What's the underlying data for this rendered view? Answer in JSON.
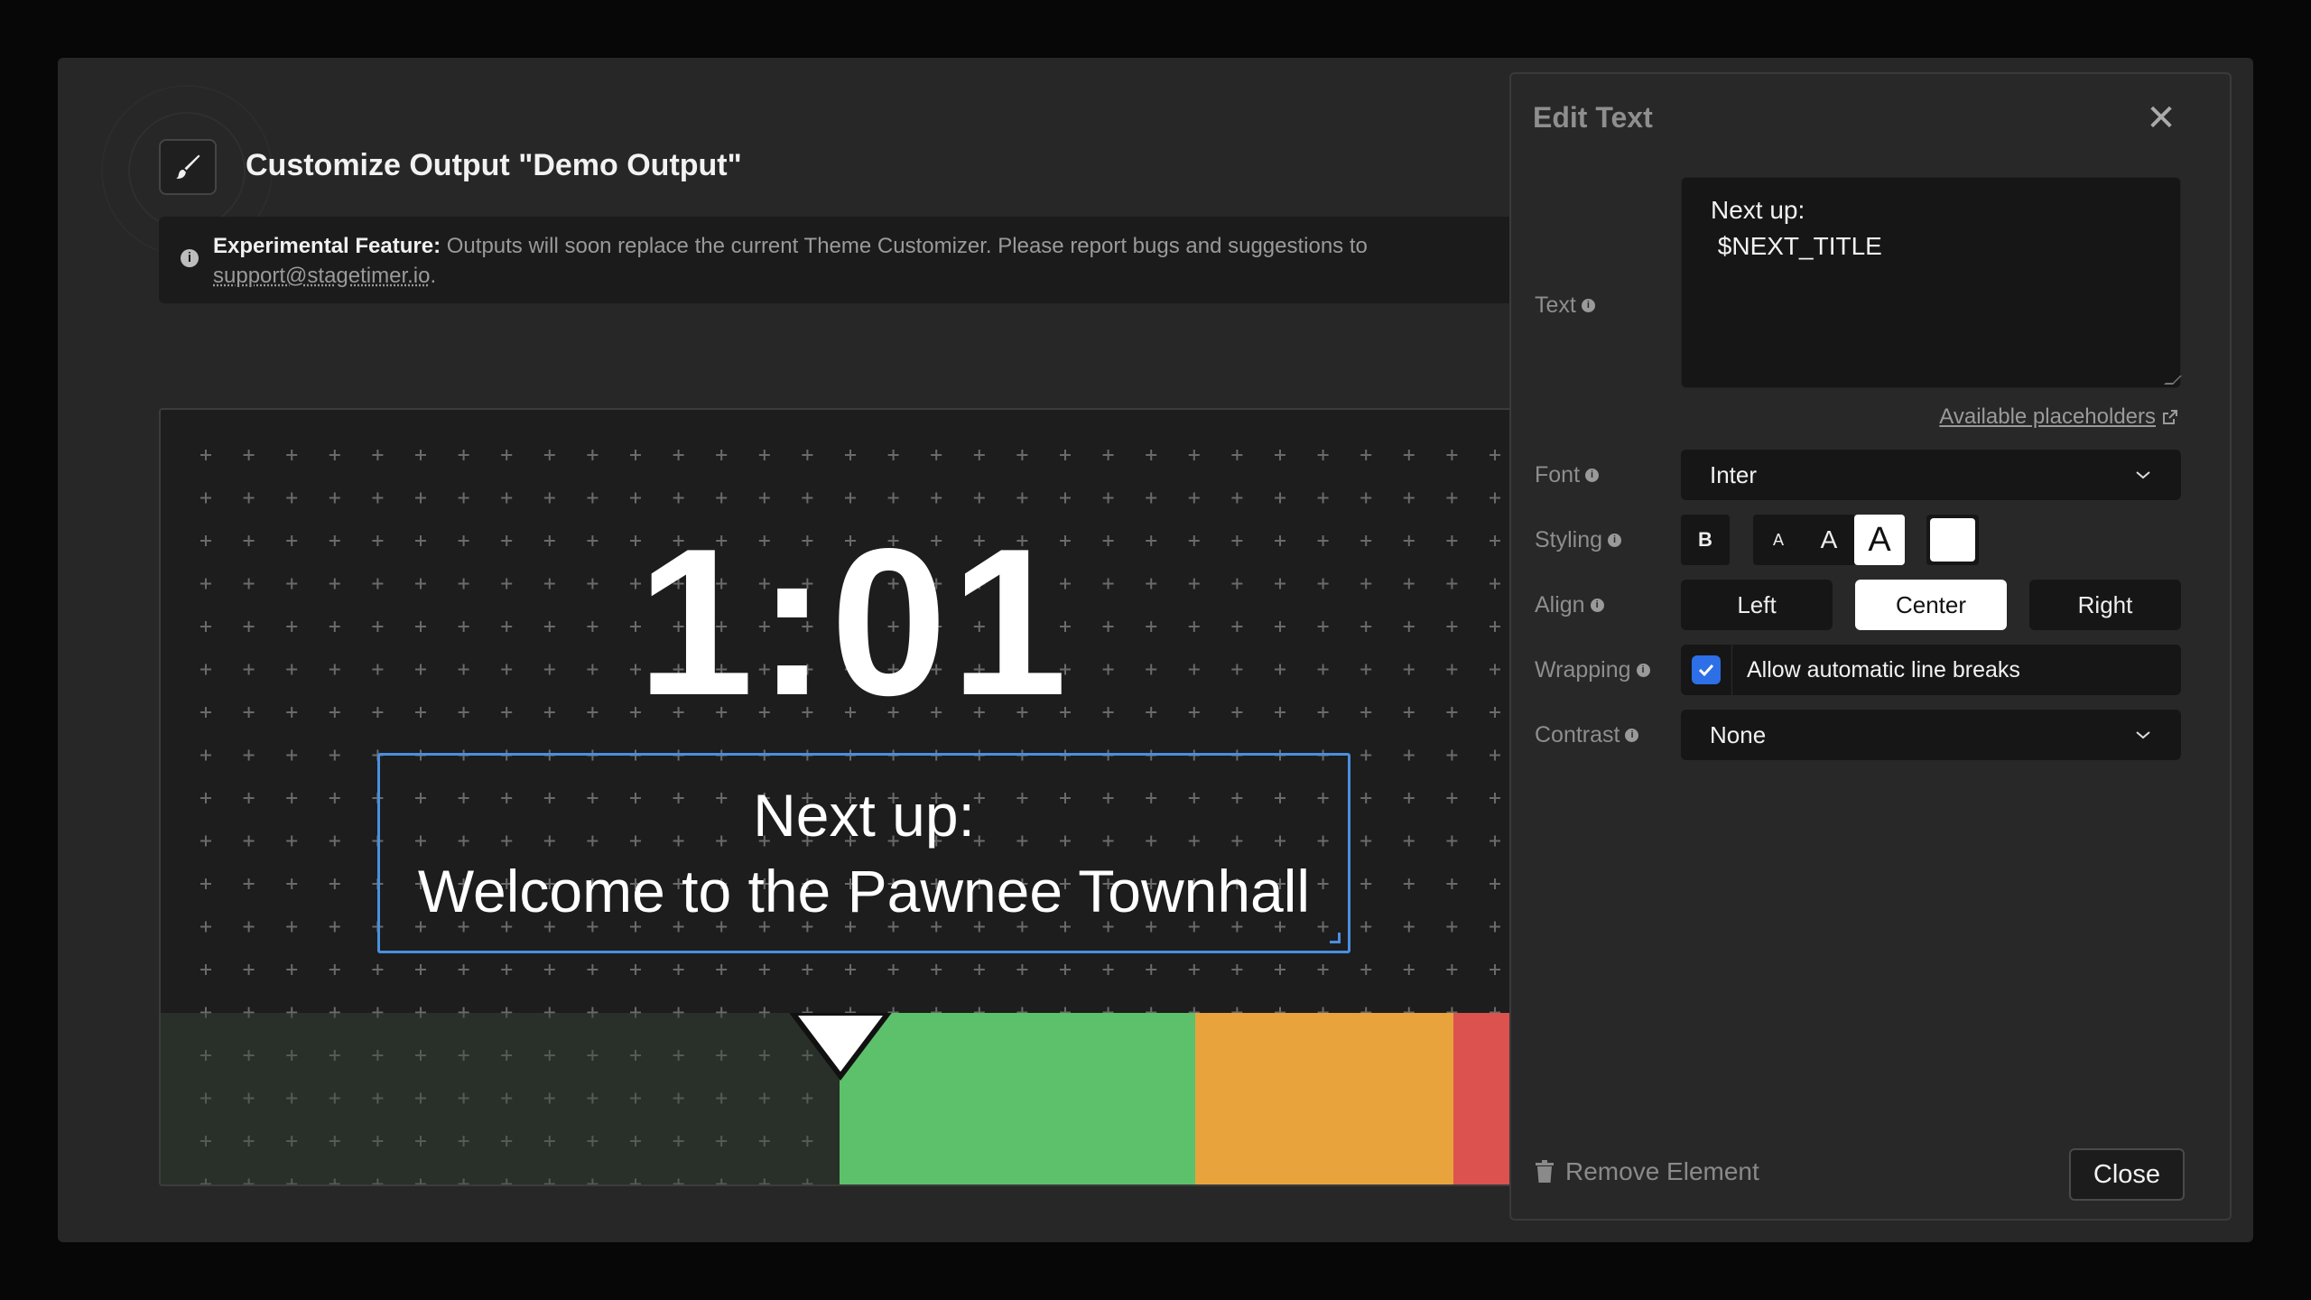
{
  "modal": {
    "title": "Customize Output \"Demo Output\"",
    "icon": "paintbrush-icon"
  },
  "notice": {
    "label": "Experimental Feature:",
    "text": " Outputs will soon replace the current Theme Customizer. Please report bugs and suggestions to ",
    "link": "support@stagetimer.io",
    "suffix": "."
  },
  "preview": {
    "timer": "1:01",
    "text_line1": "Next up:",
    "text_line2": "Welcome to the Pawnee Townhall",
    "progress_colors": {
      "elapsed": "#2f382f",
      "green": "#5cc16a",
      "orange": "#e9a33c",
      "red": "#dc524e"
    }
  },
  "panel": {
    "title": "Edit Text",
    "close_icon": "close-icon",
    "text_label": "Text",
    "text_value": "Next up:\n $NEXT_TITLE",
    "placeholders_link": "Available placeholders",
    "font_label": "Font",
    "font_value": "Inter",
    "styling_label": "Styling",
    "styling": {
      "bold": "B",
      "size_small": "A",
      "size_medium": "A",
      "size_large": "A",
      "color": "#ffffff"
    },
    "align_label": "Align",
    "align": {
      "left": "Left",
      "center": "Center",
      "right": "Right",
      "selected": "Center"
    },
    "wrapping_label": "Wrapping",
    "wrapping_checked": true,
    "wrapping_text": "Allow automatic line breaks",
    "contrast_label": "Contrast",
    "contrast_value": "None",
    "remove_label": "Remove Element",
    "close_label": "Close"
  }
}
